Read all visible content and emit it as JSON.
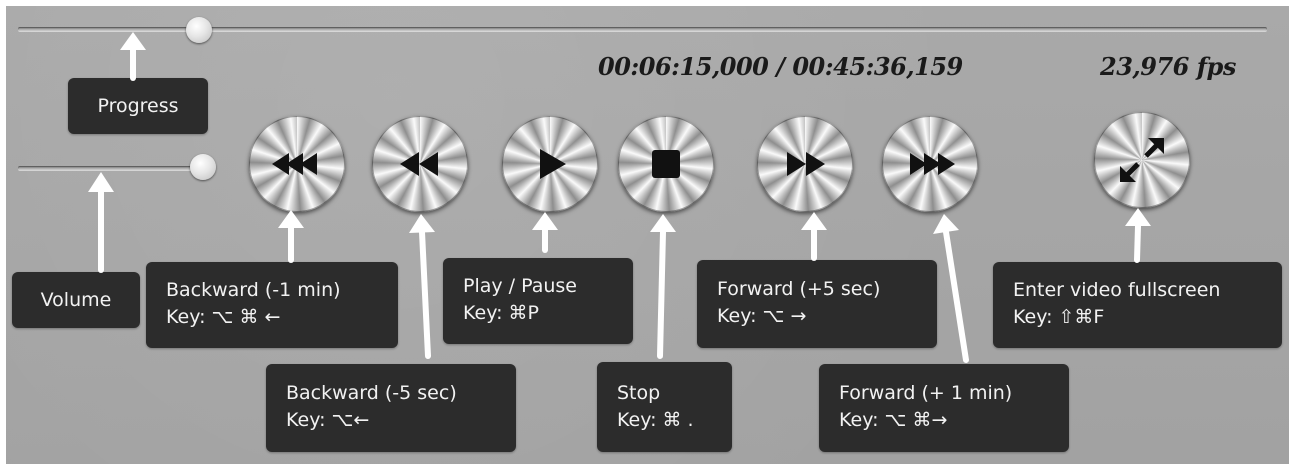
{
  "timecode": {
    "current": "00:06:15,000",
    "separator": "/",
    "total": "00:45:36,159",
    "fps": "23,976 fps"
  },
  "progress": {
    "fraction": 0.07
  },
  "volume": {
    "fraction": 1.0
  },
  "labels": {
    "progress": {
      "title": "Progress"
    },
    "volume": {
      "title": "Volume"
    },
    "backward_1min": {
      "title": "Backward (-1 min)",
      "key": "Key: ⌥ ⌘ ←"
    },
    "backward_5sec": {
      "title": "Backward (-5 sec)",
      "key": "Key: ⌥←"
    },
    "play_pause": {
      "title": "Play / Pause",
      "key": "Key: ⌘P"
    },
    "stop": {
      "title": "Stop",
      "key": "Key: ⌘ ."
    },
    "forward_5sec": {
      "title": "Forward (+5 sec)",
      "key": "Key: ⌥ →"
    },
    "forward_1min": {
      "title": "Forward (+ 1 min)",
      "key": "Key: ⌥ ⌘→"
    },
    "fullscreen": {
      "title": "Enter video fullscreen",
      "key": "Key: ⇧⌘F"
    }
  },
  "icons": {
    "backward_1min": "triple-left-triangle-icon",
    "backward_5sec": "double-left-triangle-icon",
    "play": "play-triangle-icon",
    "stop": "stop-square-icon",
    "forward_5sec": "double-right-triangle-icon",
    "forward_1min": "triple-right-triangle-icon",
    "fullscreen": "diagonal-expand-arrows-icon"
  },
  "colors": {
    "panel": "#a6a6a6",
    "label_background": "#2c2c2c",
    "label_text": "#f2f2f2",
    "readout_text": "#1a1a1a",
    "arrow": "#ffffff"
  }
}
